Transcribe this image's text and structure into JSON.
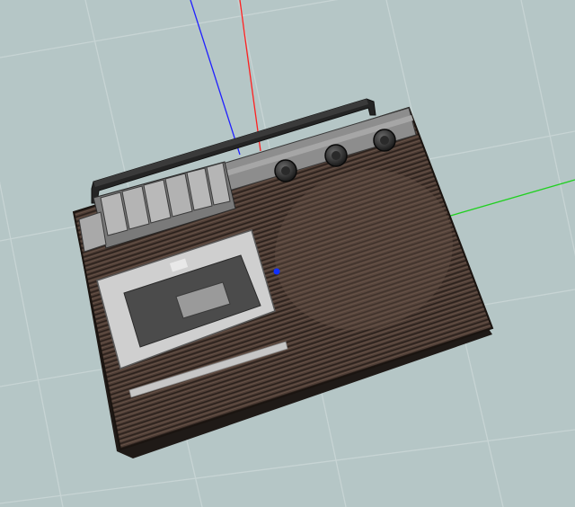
{
  "viewport": {
    "background": "#b5c6c6",
    "grid_color": "#c9d6d6",
    "grid_visible": true
  },
  "axes": {
    "x_axis_color": "#ff2020",
    "y_axis_color": "#20d020",
    "z_axis_color": "#2020ff"
  },
  "pivot": {
    "color": "#1030ff"
  },
  "model": {
    "object": "cassette-recorder",
    "body_color": "#4a3a33",
    "panel_color": "#8e8e8e",
    "cassette_door_color": "#c8c8c8",
    "handle_color": "#1e1e1e",
    "knob_count": 3,
    "piano_key_count": 6
  }
}
